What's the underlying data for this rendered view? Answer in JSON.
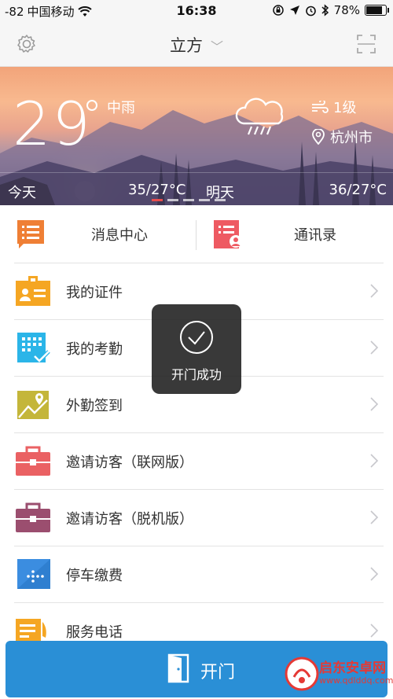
{
  "status_bar": {
    "signal": "-82",
    "carrier": "中国移动",
    "time": "16:38",
    "battery": "78%",
    "battery_level": 0.78
  },
  "nav": {
    "title": "立方"
  },
  "weather": {
    "temperature": "29",
    "condition": "中雨",
    "wind": "1级",
    "city": "杭州市",
    "today_label": "今天",
    "today_range": "35/27°C",
    "tomorrow_label": "明天",
    "tomorrow_range": "36/27°C"
  },
  "quick_actions": [
    {
      "label": "消息中心",
      "icon": "message-list-icon",
      "color": "#ef7f35"
    },
    {
      "label": "通讯录",
      "icon": "contacts-icon",
      "color": "#ee5a62"
    }
  ],
  "menu": [
    {
      "label": "我的证件",
      "icon": "id-card-icon",
      "color": "#f5a623"
    },
    {
      "label": "我的考勤",
      "icon": "attendance-calendar-icon",
      "color": "#2bb5e8"
    },
    {
      "label": "外勤签到",
      "icon": "map-pin-icon",
      "color": "#c4b63a"
    },
    {
      "label": "邀请访客（联网版）",
      "icon": "briefcase-icon",
      "color": "#ea6163"
    },
    {
      "label": "邀请访客（脱机版）",
      "icon": "briefcase-icon",
      "color": "#9b4e6f"
    },
    {
      "label": "停车缴费",
      "icon": "parking-card-icon",
      "color": "#3b8de0"
    },
    {
      "label": "服务电话",
      "icon": "phone-book-icon",
      "color": "#f5a623"
    }
  ],
  "toast": {
    "text": "开门成功"
  },
  "open_button": {
    "label": "开门"
  },
  "watermark": {
    "title": "启东安卓网",
    "url": "www.qdlddq.com"
  }
}
